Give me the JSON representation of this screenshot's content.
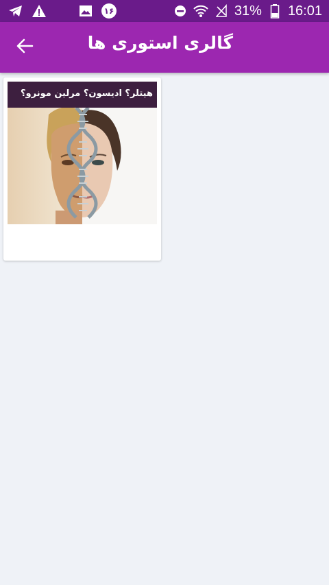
{
  "status_bar": {
    "battery": "31%",
    "time": "16:01",
    "calendar_badge": "۱۶",
    "icons": [
      "telegram-icon",
      "warning-icon",
      "moon-icon",
      "image-icon",
      "calendar-badge-icon",
      "do-not-disturb-icon",
      "wifi-icon",
      "no-signal-icon",
      "battery-icon"
    ]
  },
  "app_bar": {
    "title": "گالری استوری ها",
    "back_icon": "arrow-left-icon"
  },
  "gallery": {
    "items": [
      {
        "caption": "هیتلر؟ ادیسون؟ مرلین مونرو؟"
      }
    ]
  },
  "colors": {
    "status_bar": "#6a1b8a",
    "app_bar": "#9c27b0",
    "background": "#eff2f7",
    "card": "#ffffff"
  }
}
